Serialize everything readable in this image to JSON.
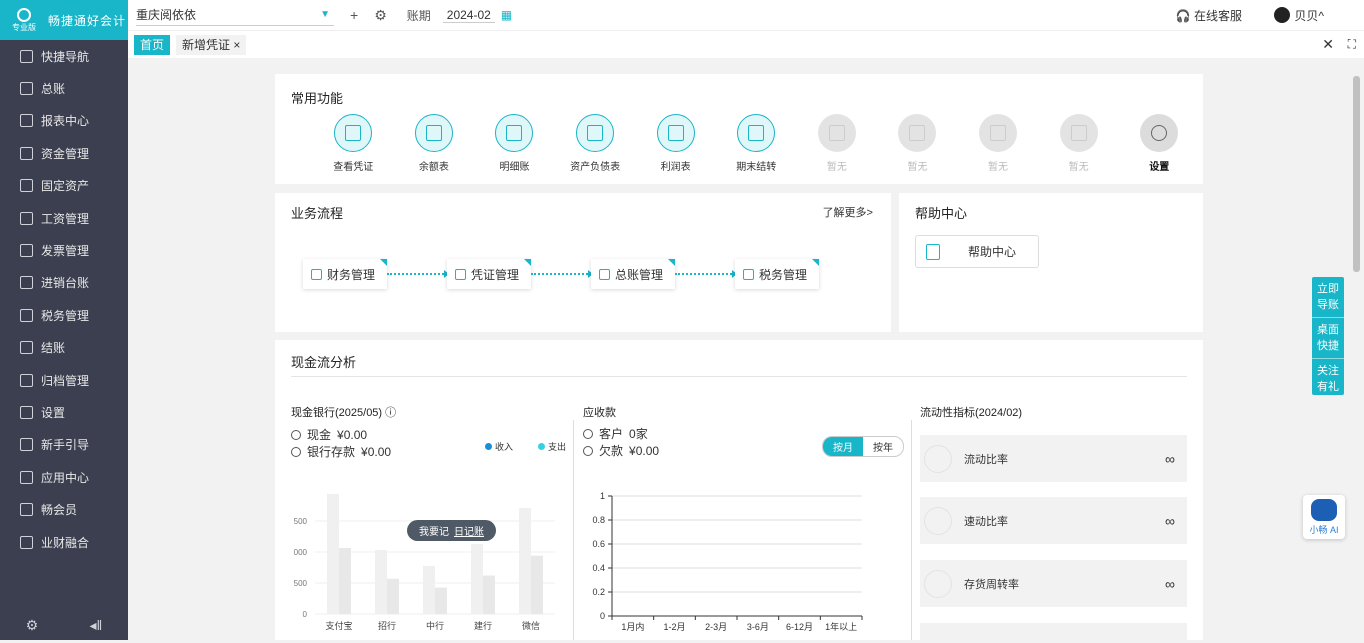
{
  "app": {
    "name": "畅捷通好会计",
    "edition": "专业版"
  },
  "sidebar": {
    "items": [
      {
        "label": "快捷导航",
        "icon": "home-icon"
      },
      {
        "label": "总账",
        "icon": "ledger-icon"
      },
      {
        "label": "报表中心",
        "icon": "report-icon"
      },
      {
        "label": "资金管理",
        "icon": "money-icon"
      },
      {
        "label": "固定资产",
        "icon": "asset-icon"
      },
      {
        "label": "工资管理",
        "icon": "salary-icon"
      },
      {
        "label": "发票管理",
        "icon": "invoice-icon"
      },
      {
        "label": "进销台账",
        "icon": "trade-icon"
      },
      {
        "label": "税务管理",
        "icon": "tax-icon"
      },
      {
        "label": "结账",
        "icon": "close-account-icon"
      },
      {
        "label": "归档管理",
        "icon": "archive-icon"
      },
      {
        "label": "设置",
        "icon": "gear-icon"
      },
      {
        "label": "新手引导",
        "icon": "guide-icon"
      },
      {
        "label": "应用中心",
        "icon": "apps-icon"
      },
      {
        "label": "畅会员",
        "icon": "vip-icon"
      },
      {
        "label": "业财融合",
        "icon": "integration-icon"
      }
    ]
  },
  "topbar": {
    "company": "重庆阅依依",
    "period_label": "账期",
    "period_value": "2024-02",
    "service": "在线客服",
    "user": "贝贝^"
  },
  "tabs": [
    {
      "label": "首页",
      "active": true
    },
    {
      "label": "新增凭证 ×",
      "active": false
    }
  ],
  "common": {
    "title": "常用功能",
    "items": [
      {
        "label": "查看凭证",
        "state": "active"
      },
      {
        "label": "余额表",
        "state": "active"
      },
      {
        "label": "明细账",
        "state": "active"
      },
      {
        "label": "资产负债表",
        "state": "active"
      },
      {
        "label": "利润表",
        "state": "active"
      },
      {
        "label": "期末结转",
        "state": "active"
      },
      {
        "label": "暂无",
        "state": "disabled"
      },
      {
        "label": "暂无",
        "state": "disabled"
      },
      {
        "label": "暂无",
        "state": "disabled"
      },
      {
        "label": "暂无",
        "state": "disabled"
      },
      {
        "label": "设置",
        "state": "settings"
      }
    ]
  },
  "flow": {
    "title": "业务流程",
    "more": "了解更多>",
    "steps": [
      "财务管理",
      "凭证管理",
      "总账管理",
      "税务管理"
    ]
  },
  "help": {
    "title": "帮助中心",
    "button": "帮助中心"
  },
  "cash": {
    "title": "现金流分析",
    "bank": {
      "title": "现金银行(2025/05)",
      "cash_label": "现金",
      "cash_value": "¥0.00",
      "deposit_label": "银行存款",
      "deposit_value": "¥0.00",
      "legend_in": "收入",
      "legend_out": "支出",
      "badge_text": "我要记",
      "badge_link": "日记账"
    },
    "receivable": {
      "title": "应收款",
      "customers_label": "客户",
      "customers_value": "0家",
      "debt_label": "欠款",
      "debt_value": "¥0.00",
      "toggle_month": "按月",
      "toggle_year": "按年"
    },
    "liquidity": {
      "title": "流动性指标(2024/02)",
      "metrics": [
        {
          "label": "流动比率",
          "value": "∞"
        },
        {
          "label": "速动比率",
          "value": "∞"
        },
        {
          "label": "存货周转率",
          "value": "∞"
        }
      ]
    }
  },
  "chart_data": [
    {
      "type": "bar",
      "categories": [
        "支付宝",
        "招行",
        "中行",
        "建行",
        "微信"
      ],
      "ytick_labels": [
        "0",
        "500",
        "000",
        "500"
      ],
      "series": [
        {
          "name": "收入",
          "values": []
        },
        {
          "name": "支出",
          "values": []
        }
      ],
      "title": "",
      "grid": true,
      "legend": "top-right"
    },
    {
      "type": "line",
      "categories": [
        "1月内",
        "1-2月",
        "2-3月",
        "3-6月",
        "6-12月",
        "1年以上"
      ],
      "yticks": [
        0,
        0.2,
        0.4,
        0.6,
        0.8,
        1
      ],
      "ytick_labels": [
        "0",
        "0.2",
        "0.4",
        "0.6",
        "0.8",
        "1"
      ],
      "ylim": [
        0,
        1
      ],
      "series": [],
      "grid": true
    }
  ],
  "floatnav": [
    "立即导账",
    "桌面快捷",
    "关注有礼"
  ],
  "bot": "小畅 AI",
  "colors": {
    "accent": "#19b5c8",
    "sidebar": "#3b3f4f",
    "income": "#1a8fd6",
    "expense": "#33d0e6"
  }
}
